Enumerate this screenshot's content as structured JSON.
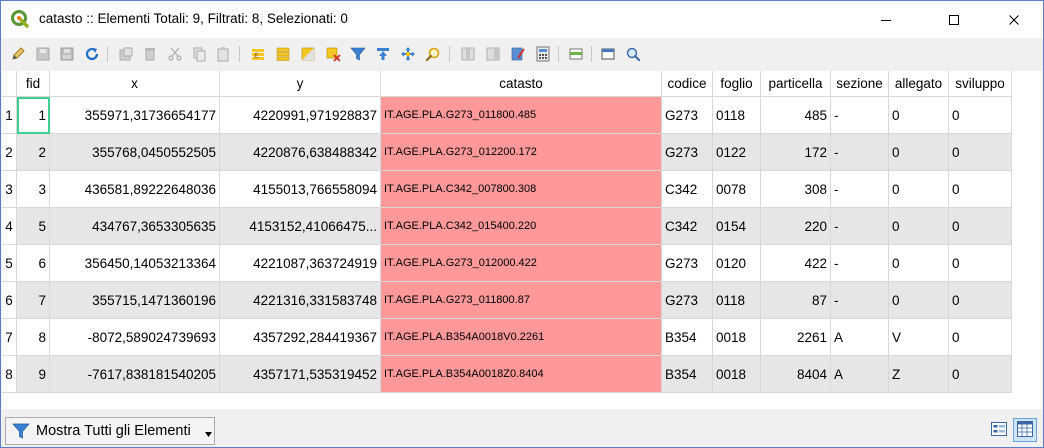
{
  "window": {
    "title": "catasto :: Elementi Totali: 9, Filtrati: 8, Selezionati: 0"
  },
  "toolbar": {
    "buttons": [
      "pencil-icon",
      "save-edits-icon",
      "save-icon",
      "reload-icon",
      "add-feature-icon",
      "delete-feature-icon",
      "cut-icon",
      "copy-icon",
      "paste-icon",
      "select-by-expression-icon",
      "select-all-icon",
      "invert-selection-icon",
      "deselect-all-icon",
      "filter-icon",
      "move-to-top-icon",
      "pan-to-selection-icon",
      "zoom-to-selection-icon",
      "new-field-icon",
      "delete-field-icon",
      "edit-field-icon",
      "field-calculator-icon",
      "conditional-formatting-icon",
      "actions-icon",
      "dock-icon"
    ]
  },
  "table": {
    "columns": [
      "fid",
      "x",
      "y",
      "catasto",
      "codice",
      "foglio",
      "particella",
      "sezione",
      "allegato",
      "sviluppo"
    ],
    "rows": [
      {
        "num": "1",
        "fid": "1",
        "x": "355971,31736654177",
        "y": "4220991,971928837",
        "catasto": "IT.AGE.PLA.G273_011800.485",
        "codice": "G273",
        "foglio": "0118",
        "particella": "485",
        "sezione": "-",
        "allegato": "0",
        "sviluppo": "0"
      },
      {
        "num": "2",
        "fid": "2",
        "x": "355768,0450552505",
        "y": "4220876,638488342",
        "catasto": "IT.AGE.PLA.G273_012200.172",
        "codice": "G273",
        "foglio": "0122",
        "particella": "172",
        "sezione": "-",
        "allegato": "0",
        "sviluppo": "0"
      },
      {
        "num": "3",
        "fid": "3",
        "x": "436581,89222648036",
        "y": "4155013,766558094",
        "catasto": "IT.AGE.PLA.C342_007800.308",
        "codice": "C342",
        "foglio": "0078",
        "particella": "308",
        "sezione": "-",
        "allegato": "0",
        "sviluppo": "0"
      },
      {
        "num": "4",
        "fid": "5",
        "x": "434767,3653305635",
        "y": "4153152,41066475...",
        "catasto": "IT.AGE.PLA.C342_015400.220",
        "codice": "C342",
        "foglio": "0154",
        "particella": "220",
        "sezione": "-",
        "allegato": "0",
        "sviluppo": "0"
      },
      {
        "num": "5",
        "fid": "6",
        "x": "356450,14053213364",
        "y": "4221087,363724919",
        "catasto": "IT.AGE.PLA.G273_012000.422",
        "codice": "G273",
        "foglio": "0120",
        "particella": "422",
        "sezione": "-",
        "allegato": "0",
        "sviluppo": "0"
      },
      {
        "num": "6",
        "fid": "7",
        "x": "355715,1471360196",
        "y": "4221316,331583748",
        "catasto": "IT.AGE.PLA.G273_011800.87",
        "codice": "G273",
        "foglio": "0118",
        "particella": "87",
        "sezione": "-",
        "allegato": "0",
        "sviluppo": "0"
      },
      {
        "num": "7",
        "fid": "8",
        "x": "-8072,589024739693",
        "y": "4357292,284419367",
        "catasto": "IT.AGE.PLA.B354A0018V0.2261",
        "codice": "B354",
        "foglio": "0018",
        "particella": "2261",
        "sezione": "A",
        "allegato": "V",
        "sviluppo": "0"
      },
      {
        "num": "8",
        "fid": "9",
        "x": "-7617,838181540205",
        "y": "4357171,535319452",
        "catasto": "IT.AGE.PLA.B354A0018Z0.8404",
        "codice": "B354",
        "foglio": "0018",
        "particella": "8404",
        "sezione": "A",
        "allegato": "Z",
        "sviluppo": "0"
      }
    ]
  },
  "bottom": {
    "filter_label": "Mostra Tutti gli Elementi"
  },
  "colors": {
    "catasto_highlight": "#ff9999",
    "alt_row": "#e6e6e6",
    "focus": "#3ccf8e"
  }
}
